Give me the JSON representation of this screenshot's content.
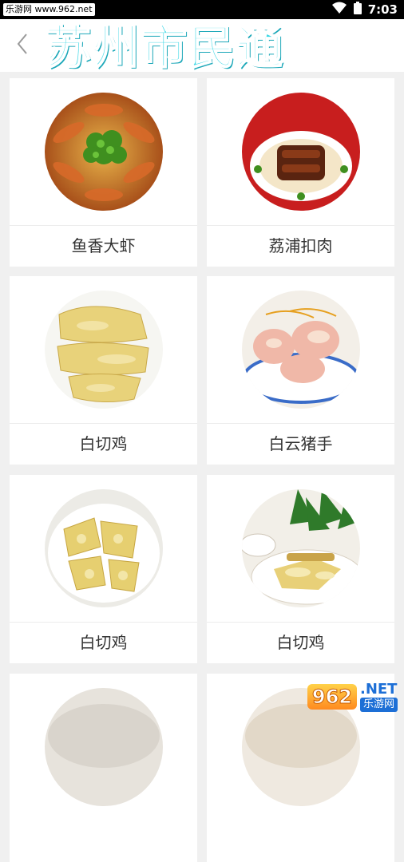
{
  "status_bar": {
    "source_text": "乐游网 www.962.net",
    "time": "7:03"
  },
  "header": {
    "title": "苏州市民通"
  },
  "dishes": [
    {
      "name": "鱼香大虾"
    },
    {
      "name": "荔浦扣肉"
    },
    {
      "name": "白切鸡"
    },
    {
      "name": "白云猪手"
    },
    {
      "name": "白切鸡"
    },
    {
      "name": "白切鸡"
    },
    {
      "name": ""
    },
    {
      "name": ""
    }
  ],
  "watermark": {
    "number": "962",
    "net": ".NET",
    "site": "乐游网"
  },
  "colors": {
    "title": "#3dd8e6",
    "background": "#f0f0f0",
    "card": "#ffffff"
  }
}
